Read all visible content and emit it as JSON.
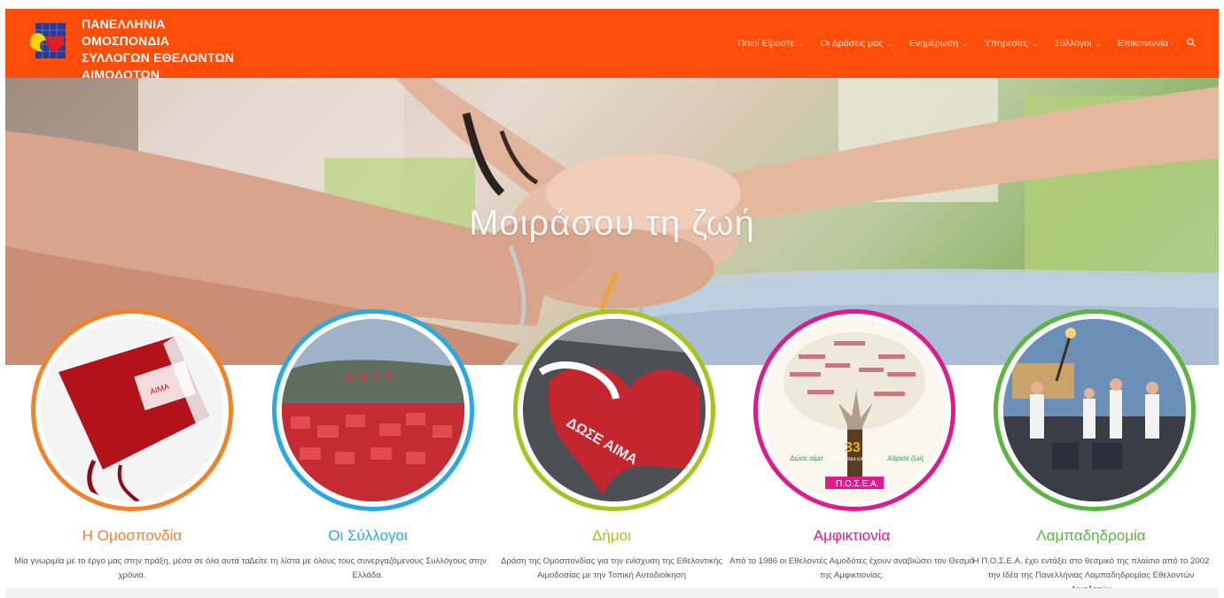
{
  "header": {
    "logo_lines": [
      "ΠΑΝΕΛΛΗΝΙΑ ΟΜΟΣΠΟΝΔΙΑ",
      "ΣΥΛΛΟΓΩΝ ΕΘΕΛΟΝΤΩΝ",
      "ΑΙΜΟΔΟΤΩΝ"
    ],
    "nav": [
      {
        "label": "Ποιοί Είμαστε",
        "has_dropdown": true
      },
      {
        "label": "Οι Δράσεις μας",
        "has_dropdown": true
      },
      {
        "label": "Ενημέρωση",
        "has_dropdown": true
      },
      {
        "label": "Υπηρεσίες",
        "has_dropdown": true
      },
      {
        "label": "Σύλλογοι",
        "has_dropdown": true
      },
      {
        "label": "Επικοινωνία",
        "has_dropdown": false
      }
    ],
    "search_icon": "search-icon",
    "brand_color": "#ff4d0a"
  },
  "hero": {
    "title": "Μοιράσου τη ζωή"
  },
  "cards": [
    {
      "title": "Η Ομοσπονδία",
      "text": "Μία γνωριμία με το έργο μας στην πράξη, μέσα σε όλα αυτά τα χρόνια.",
      "color": "#f0832a"
    },
    {
      "title": "Οι Σύλλογοι",
      "text": "Δείτε τη λίστα με όλους τους συνεργαζόμενους Συλλόγους στην Ελλάδα.",
      "color": "#27a9e1"
    },
    {
      "title": "Δήμοι",
      "text": "Δράση της Ομοσπονδίας για την ενίσχυση της Εθελοντικής Αιμοδοσίας με την Τοπική Αυτοδιοίκηση",
      "color": "#a6c51c"
    },
    {
      "title": "Αμφικτιονία",
      "text": "Από το 1986 οι Εθελοντές Αιμοδότες έχουν αναβιώσει τον Θεσμό της Αμφικτιονίας.",
      "color": "#e0198e"
    },
    {
      "title": "Λαμπαδηδρομία",
      "text": "Η Π.Ο.Σ.Ε.Α. έχει εντάξει στο θεσμικό της πλαίσιο από το 2002 την Ιδέα της Πανελλήνιας Λαμπαδηδρομίας Εθελοντών Αιμοδοτών",
      "color": "#5ab541"
    }
  ],
  "images": {
    "card1_label": "ΑΙΜΑ",
    "card2_sign": "ΑΟΣΕ",
    "card3_road": "ΔΩΣΕ ΑΙΜΑ",
    "card4_badge": "33",
    "card4_caption": "ΑΜΦΙΚΤΙΟΝΙΑ ΚΑΣΤΟΡΙΑ",
    "card4_left": "Δώσε αίμα",
    "card4_right": "Χάρισε ζωή",
    "card4_logo": "Π.Ο.Σ.Ε.Α."
  }
}
